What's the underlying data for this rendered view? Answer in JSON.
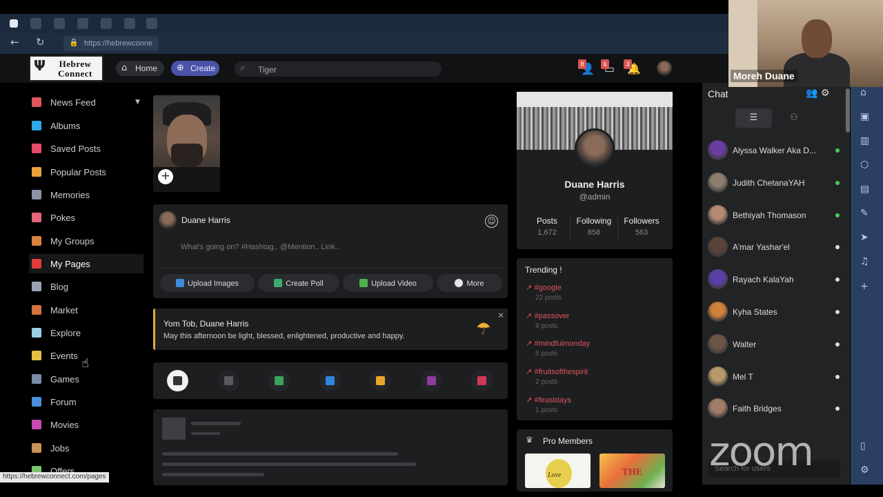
{
  "browser": {
    "url": "https://hebrewconne",
    "status_url": "https://hebrewconnect.com/pages"
  },
  "header": {
    "logo_text": "Hebrew Connect",
    "home_label": "Home",
    "create_label": "Create",
    "search_value": "Tiger",
    "badges": {
      "friend_requests": "8",
      "messages": "6",
      "notifications": "3"
    }
  },
  "sidebar": {
    "items": [
      {
        "label": "News Feed",
        "icon": "home-icon",
        "color": "#e0545b"
      },
      {
        "label": "Albums",
        "icon": "albums-icon",
        "color": "#2fa7e6"
      },
      {
        "label": "Saved Posts",
        "icon": "bookmark-icon",
        "color": "#e84a6a"
      },
      {
        "label": "Popular Posts",
        "icon": "fire-icon",
        "color": "#e9a13b"
      },
      {
        "label": "Memories",
        "icon": "memories-icon",
        "color": "#8a94a6"
      },
      {
        "label": "Pokes",
        "icon": "poke-icon",
        "color": "#e5667a"
      },
      {
        "label": "My Groups",
        "icon": "groups-icon",
        "color": "#d8843d"
      },
      {
        "label": "My Pages",
        "icon": "flag-icon",
        "color": "#e23b3b"
      },
      {
        "label": "Blog",
        "icon": "blog-icon",
        "color": "#9aa2b1"
      },
      {
        "label": "Market",
        "icon": "market-icon",
        "color": "#d4733e"
      },
      {
        "label": "Explore",
        "icon": "explore-icon",
        "color": "#9ad1e6"
      },
      {
        "label": "Events",
        "icon": "events-icon",
        "color": "#e3c144"
      },
      {
        "label": "Games",
        "icon": "games-icon",
        "color": "#7b8ca6"
      },
      {
        "label": "Forum",
        "icon": "forum-icon",
        "color": "#4a90d9"
      },
      {
        "label": "Movies",
        "icon": "movies-icon",
        "color": "#c94ab5"
      },
      {
        "label": "Jobs",
        "icon": "jobs-icon",
        "color": "#c8915a"
      },
      {
        "label": "Offers",
        "icon": "offers-icon",
        "color": "#7bc46b"
      }
    ]
  },
  "composer": {
    "user_name": "Duane Harris",
    "placeholder": "What's going on? #Hashtag.. @Mention.. Link..",
    "buttons": [
      "Upload Images",
      "Create Poll",
      "Upload Video",
      "More"
    ]
  },
  "greeting": {
    "title": "Yom Tob, Duane Harris",
    "text": "May this afternoon be light, blessed, enlightened, productive and happy."
  },
  "profile_card": {
    "name": "Duane Harris",
    "handle": "@admin",
    "stats": [
      {
        "label": "Posts",
        "value": "1,672"
      },
      {
        "label": "Following",
        "value": "858"
      },
      {
        "label": "Followers",
        "value": "563"
      }
    ]
  },
  "trending": {
    "title": "Trending !",
    "tags": [
      {
        "tag": "#google",
        "count": "22 posts"
      },
      {
        "tag": "#passover",
        "count": "9 posts"
      },
      {
        "tag": "#mindfulmonday",
        "count": "5 posts"
      },
      {
        "tag": "#fruitsofthespirit",
        "count": "2 posts"
      },
      {
        "tag": "#feastdays",
        "count": "1 posts"
      }
    ]
  },
  "pro_members": {
    "title": "Pro Members",
    "card1_text": "Love",
    "card2_text": "THE"
  },
  "chat": {
    "title": "Chat",
    "search_placeholder": "Search for users",
    "users": [
      {
        "name": "Alyssa Walker Aka D...",
        "online": true,
        "avatar": "#6a3ea1"
      },
      {
        "name": "Judith ChetanaYAH",
        "online": true,
        "avatar": "#8c7d6e"
      },
      {
        "name": "Bethiyah Thomason",
        "online": true,
        "avatar": "#b58a74"
      },
      {
        "name": "A'mar Yashar'el",
        "online": false,
        "avatar": "#5a4338"
      },
      {
        "name": "Rayach KalaYah",
        "online": false,
        "avatar": "#5b3fa8"
      },
      {
        "name": "Kyha States",
        "online": false,
        "avatar": "#d0813a"
      },
      {
        "name": "Walter",
        "online": false,
        "avatar": "#6c5546"
      },
      {
        "name": "Mel T",
        "online": false,
        "avatar": "#b89a6a"
      },
      {
        "name": "Faith Bridges",
        "online": false,
        "avatar": "#a27c69"
      }
    ],
    "online_color": "#4ccb5a",
    "offline_color": "#dddddd"
  },
  "zoom": {
    "participant_name": "Moreh Duane",
    "watermark": "zoom"
  }
}
